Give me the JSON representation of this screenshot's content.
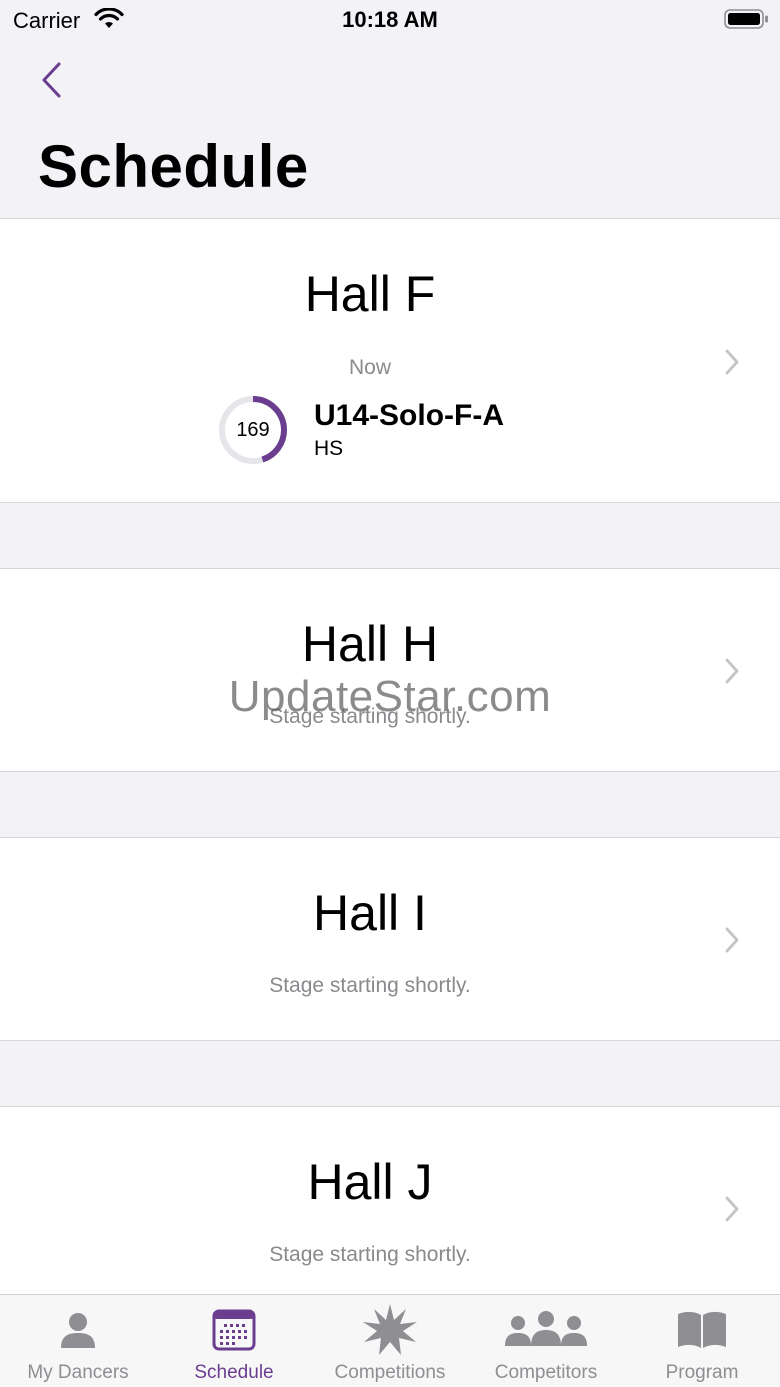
{
  "status_bar": {
    "carrier": "Carrier",
    "time": "10:18 AM"
  },
  "header": {
    "title": "Schedule"
  },
  "colors": {
    "accent": "#6a3d8f",
    "secondary_text": "#8a8a8e",
    "background": "#f2f2f7"
  },
  "halls": [
    {
      "name": "Hall F",
      "now_label": "Now",
      "current_number": "169",
      "current_progress": 0.45,
      "event_name": "U14-Solo-F-A",
      "event_sub": "HS"
    },
    {
      "name": "Hall H",
      "status": "Stage starting shortly."
    },
    {
      "name": "Hall I",
      "status": "Stage starting shortly."
    },
    {
      "name": "Hall J",
      "status": "Stage starting shortly."
    }
  ],
  "watermark": "UpdateStar.com",
  "tabs": [
    {
      "label": "My Dancers",
      "icon": "person-icon"
    },
    {
      "label": "Schedule",
      "icon": "calendar-icon",
      "active": true
    },
    {
      "label": "Competitions",
      "icon": "starburst-icon"
    },
    {
      "label": "Competitors",
      "icon": "group-icon"
    },
    {
      "label": "Program",
      "icon": "book-icon"
    }
  ]
}
